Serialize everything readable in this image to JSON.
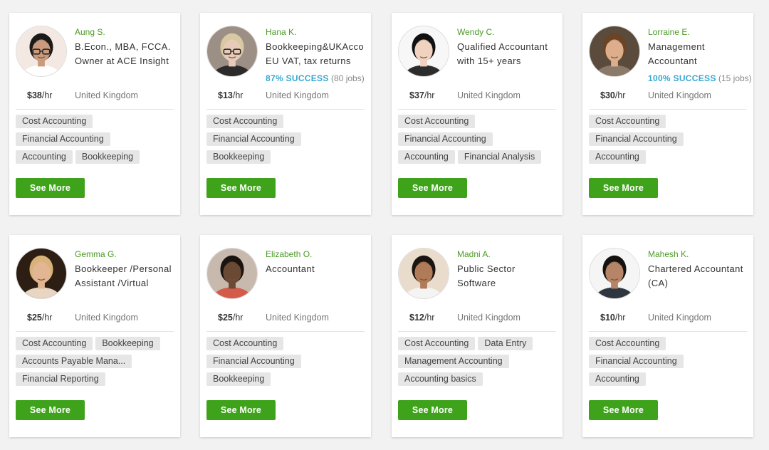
{
  "see_more_label": "See More",
  "colors": {
    "name_green": "#4b9a26",
    "success_blue": "#37a7d1",
    "button_green": "#3ea31a"
  },
  "cards": [
    {
      "name": "Aung S.",
      "title_lines": [
        "B.Econ., MBA, FCCA.",
        "Owner at ACE Insight"
      ],
      "success_pct": "",
      "success_jobs": "",
      "rate": "$38",
      "rate_unit": "/hr",
      "location": "United Kingdom",
      "skill_rows": [
        [
          "Cost Accounting"
        ],
        [
          "Financial Accounting"
        ],
        [
          "Accounting",
          "Bookkeeping"
        ]
      ]
    },
    {
      "name": "Hana K.",
      "title_lines": [
        "Bookkeeping&UKAcco",
        "EU VAT, tax returns"
      ],
      "success_pct": "87% SUCCESS",
      "success_jobs": "(80 jobs)",
      "rate": "$13",
      "rate_unit": "/hr",
      "location": "United Kingdom",
      "skill_rows": [
        [
          "Cost Accounting"
        ],
        [
          "Financial Accounting"
        ],
        [
          "Bookkeeping"
        ]
      ]
    },
    {
      "name": "Wendy C.",
      "title_lines": [
        "Qualified Accountant",
        "with 15+ years"
      ],
      "success_pct": "",
      "success_jobs": "",
      "rate": "$37",
      "rate_unit": "/hr",
      "location": "United Kingdom",
      "skill_rows": [
        [
          "Cost Accounting"
        ],
        [
          "Financial Accounting"
        ],
        [
          "Accounting",
          "Financial Analysis"
        ]
      ]
    },
    {
      "name": "Lorraine E.",
      "title_lines": [
        "Management",
        "Accountant"
      ],
      "success_pct": "100% SUCCESS",
      "success_jobs": "(15 jobs)",
      "rate": "$30",
      "rate_unit": "/hr",
      "location": "United Kingdom",
      "skill_rows": [
        [
          "Cost Accounting"
        ],
        [
          "Financial Accounting"
        ],
        [
          "Accounting"
        ]
      ]
    },
    {
      "name": "Gemma G.",
      "title_lines": [
        "Bookkeeper /Personal",
        "Assistant /Virtual"
      ],
      "success_pct": "",
      "success_jobs": "",
      "rate": "$25",
      "rate_unit": "/hr",
      "location": "United Kingdom",
      "skill_rows": [
        [
          "Cost Accounting",
          "Bookkeeping"
        ],
        [
          "Accounts Payable Mana..."
        ],
        [
          "Financial Reporting"
        ]
      ]
    },
    {
      "name": "Elizabeth O.",
      "title_lines": [
        "Accountant"
      ],
      "success_pct": "",
      "success_jobs": "",
      "rate": "$25",
      "rate_unit": "/hr",
      "location": "United Kingdom",
      "skill_rows": [
        [
          "Cost Accounting"
        ],
        [
          "Financial Accounting"
        ],
        [
          "Bookkeeping"
        ]
      ]
    },
    {
      "name": "Madni A.",
      "title_lines": [
        "Public Sector",
        "Software"
      ],
      "success_pct": "",
      "success_jobs": "",
      "rate": "$12",
      "rate_unit": "/hr",
      "location": "United Kingdom",
      "skill_rows": [
        [
          "Cost Accounting",
          "Data Entry"
        ],
        [
          "Management Accounting"
        ],
        [
          "Accounting basics"
        ]
      ]
    },
    {
      "name": "Mahesh K.",
      "title_lines": [
        "Chartered Accountant",
        "(CA)"
      ],
      "success_pct": "",
      "success_jobs": "",
      "rate": "$10",
      "rate_unit": "/hr",
      "location": "United Kingdom",
      "skill_rows": [
        [
          "Cost Accounting"
        ],
        [
          "Financial Accounting"
        ],
        [
          "Accounting"
        ]
      ]
    }
  ]
}
